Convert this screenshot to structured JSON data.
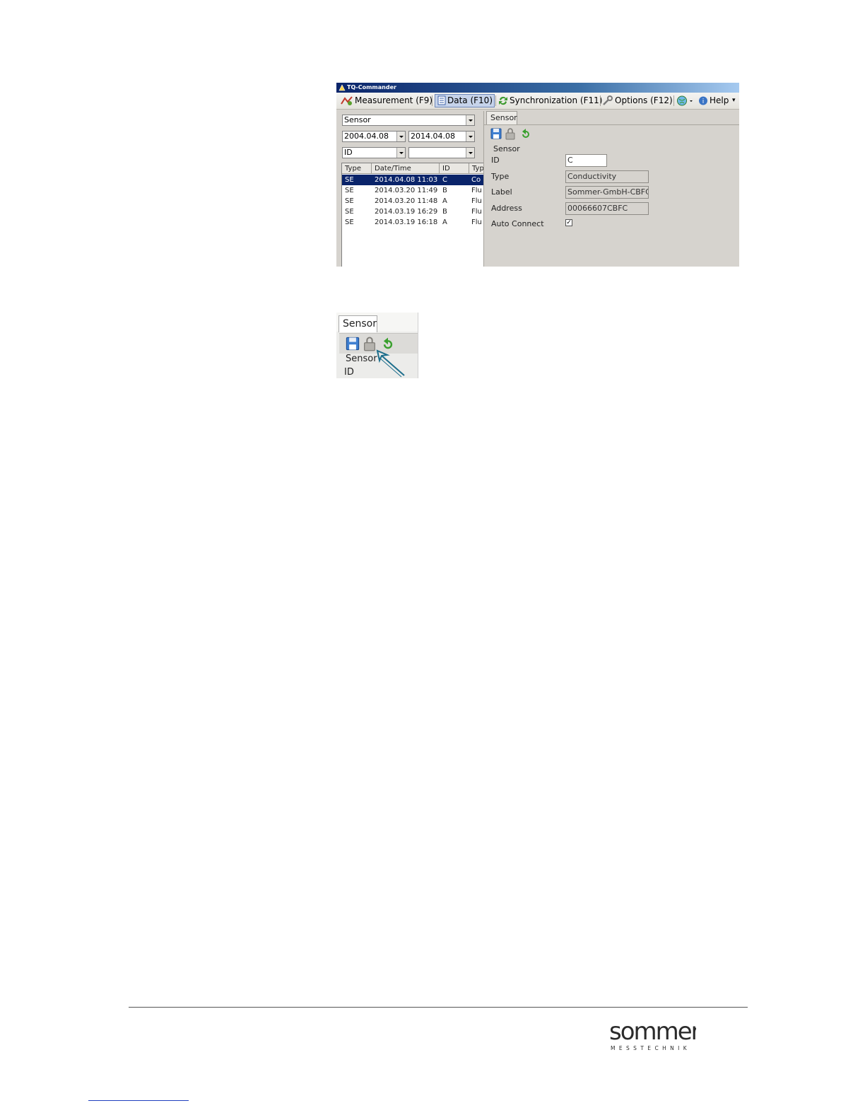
{
  "app": {
    "window_title": "TQ-Commander",
    "menu": [
      {
        "label": "Measurement (F9)",
        "icon": "measurement-icon"
      },
      {
        "label": "Data (F10)",
        "icon": "data-icon",
        "active": true
      },
      {
        "label": "Synchronization (F11)",
        "icon": "sync-icon"
      },
      {
        "label": "Options (F12)",
        "icon": "wrench-icon"
      },
      {
        "label": "",
        "icon": "globe-icon"
      },
      {
        "label": "Help",
        "icon": "help-icon"
      }
    ],
    "filters": {
      "category": "Sensor",
      "date_from": "2004.04.08",
      "date_to": "2014.04.08",
      "field": "ID",
      "field_value": ""
    },
    "table": {
      "headers": [
        "Type",
        "Date/Time",
        "ID",
        "Typ"
      ],
      "rows": [
        [
          "SE",
          "2014.04.08 11:03",
          "C",
          "Co"
        ],
        [
          "SE",
          "2014.03.20 11:49",
          "B",
          "Flu"
        ],
        [
          "SE",
          "2014.03.20 11:48",
          "A",
          "Flu"
        ],
        [
          "SE",
          "2014.03.19 16:29",
          "B",
          "Flu"
        ],
        [
          "SE",
          "2014.03.19 16:18",
          "A",
          "Flu"
        ]
      ],
      "selected_row": 0
    },
    "detail": {
      "tab": "Sensor",
      "group_label": "Sensor",
      "fields": {
        "id_label": "ID",
        "id_value": "C",
        "type_label": "Type",
        "type_value": "Conductivity",
        "label_label": "Label",
        "label_value": "Sommer-GmbH-CBFC",
        "address_label": "Address",
        "address_value": "00066607CBFC",
        "auto_connect_label": "Auto Connect",
        "auto_connect_checked": true
      }
    }
  },
  "zoom": {
    "tab": "Sensor",
    "group_label": "Sensor",
    "id_label": "ID"
  },
  "footer": {
    "logo_text": "sommer",
    "logo_subtext": "MESSTECHNIK",
    "colors": {
      "logo": "#2b2b2b",
      "accent": "#1f3fbf"
    }
  }
}
